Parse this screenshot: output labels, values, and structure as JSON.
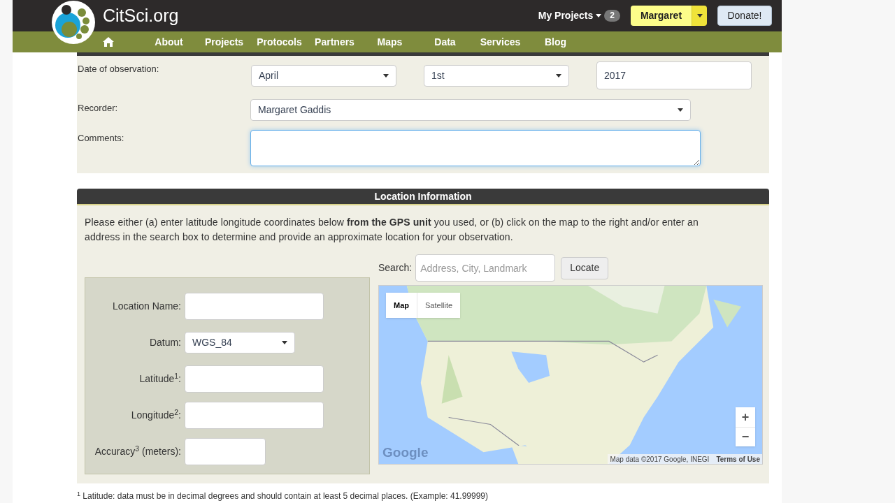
{
  "header": {
    "site_name": "CitSci.org",
    "my_projects": {
      "label": "My Projects",
      "count": "2"
    },
    "user_button": "Margaret",
    "donate_button": "Donate!"
  },
  "nav": [
    "About",
    "Projects",
    "Protocols",
    "Partners",
    "Maps",
    "Data",
    "Services",
    "Blog"
  ],
  "observation": {
    "date_label": "Date of observation:",
    "month": "April",
    "day": "1st",
    "year": "2017",
    "recorder_label": "Recorder:",
    "recorder": "Margaret Gaddis",
    "comments_label": "Comments:"
  },
  "location": {
    "title": "Location Information",
    "intro": "Please either (a) enter latitude longitude coordinates below **from the GPS unit** you used, or (b) click on the map to the right and/or enter an address in the search box to determine and provide an approximate location for your observation.",
    "search_label": "Search:",
    "search_placeholder": "Address, City, Landmark",
    "locate_button": "Locate",
    "fields": [
      {
        "kind": "text",
        "label": "Location Name:"
      },
      {
        "kind": "select",
        "label": "Datum:",
        "value": "WGS_84"
      },
      {
        "kind": "text",
        "label": "Latitude$^{1}$:"
      },
      {
        "kind": "text",
        "label": "Longitude$^{2}$:"
      },
      {
        "kind": "short",
        "label": "Accuracy$^{3}$ (meters):"
      }
    ],
    "map": {
      "tabs": [
        {
          "label": "Map",
          "selected": true
        },
        {
          "label": "Satellite",
          "selected": false
        }
      ],
      "zoom_in": "+",
      "zoom_out": "−",
      "logo": "Google",
      "attribution": "Map data ©2017 Google, INEGI",
      "terms": "Terms of Use"
    }
  },
  "footnote": "$^{1}$ Latitude: data must be in decimal degrees and should contain at least 5 decimal places. (Example: 41.99999)"
}
